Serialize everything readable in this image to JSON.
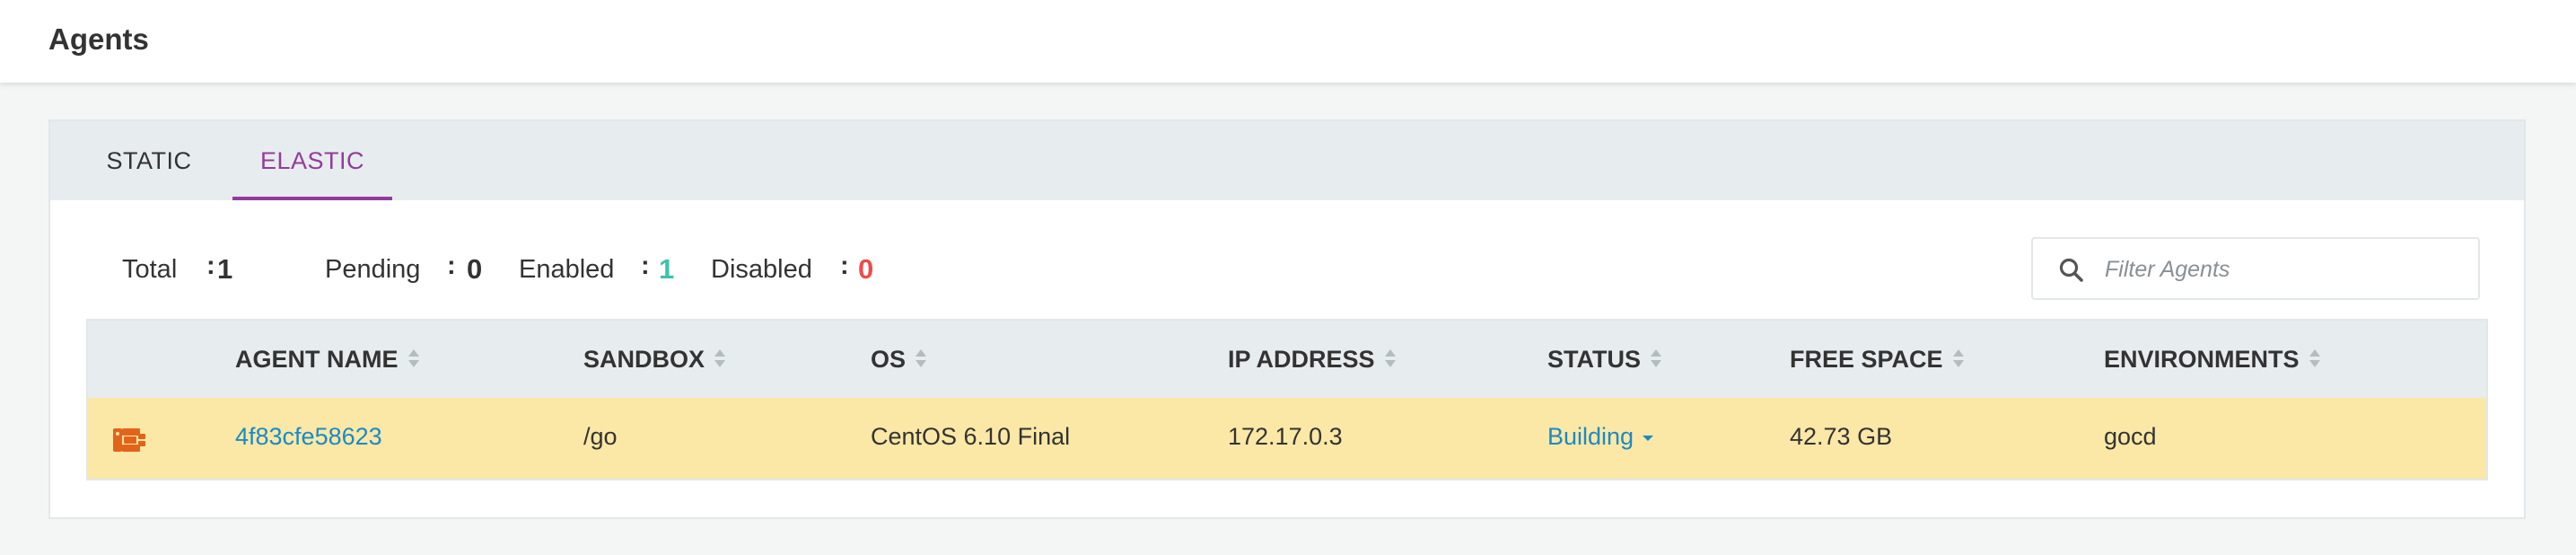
{
  "header": {
    "title": "Agents"
  },
  "tabs": [
    {
      "label": "STATIC",
      "active": false
    },
    {
      "label": "ELASTIC",
      "active": true
    }
  ],
  "stats": {
    "total": {
      "label": "Total",
      "value": "1"
    },
    "pending": {
      "label": "Pending",
      "value": "0"
    },
    "enabled": {
      "label": "Enabled",
      "value": "1"
    },
    "disabled": {
      "label": "Disabled",
      "value": "0"
    },
    "colon": ":"
  },
  "search": {
    "placeholder": "Filter Agents",
    "value": "",
    "icon": "search-icon"
  },
  "table": {
    "columns": [
      "AGENT NAME",
      "SANDBOX",
      "OS",
      "IP ADDRESS",
      "STATUS",
      "FREE SPACE",
      "ENVIRONMENTS"
    ],
    "rows": [
      {
        "icon": "elastic-agent-icon",
        "agent_name": "4f83cfe58623",
        "sandbox": "/go",
        "os": "CentOS 6.10 Final",
        "ip_address": "172.17.0.3",
        "status": "Building",
        "free_space": "42.73 GB",
        "environments": "gocd"
      }
    ]
  },
  "colors": {
    "accent": "#943a9e",
    "link": "#1b8ac5",
    "enabled": "#3ec1ae",
    "disabled": "#f04a4a",
    "row_building": "#fbe8a6",
    "agent_icon": "#e2641b"
  }
}
